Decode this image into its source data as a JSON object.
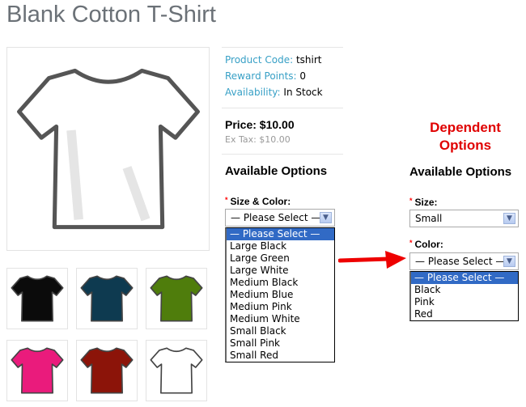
{
  "product": {
    "title": "Blank Cotton T-Shirt",
    "code_label": "Product Code:",
    "code": "tshirt",
    "points_label": "Reward Points:",
    "points": "0",
    "avail_label": "Availability:",
    "avail": "In Stock",
    "price": "Price: $10.00",
    "extax": "Ex Tax: $10.00"
  },
  "thumbnails": [
    {
      "color": "#0b0b0b"
    },
    {
      "color": "#0e3a50"
    },
    {
      "color": "#4f7d0c"
    },
    {
      "color": "#ea1b7c"
    },
    {
      "color": "#8c1409"
    },
    {
      "color": "#ffffff"
    }
  ],
  "left_options": {
    "heading": "Available Options",
    "label": "Size & Color:",
    "selected": "— Please Select —",
    "items": [
      "— Please Select —",
      "Large Black",
      "Large Green",
      "Large White",
      "Medium Black",
      "Medium Blue",
      "Medium Pink",
      "Medium White",
      "Small Black",
      "Small Pink",
      "Small Red"
    ]
  },
  "annotation": {
    "line1": "Dependent",
    "line2": "Options",
    "color": "#e00000"
  },
  "right_options": {
    "heading": "Available Options",
    "size_label": "Size:",
    "size_value": "Small",
    "color_label": "Color:",
    "color_selected": "— Please Select —",
    "items": [
      "— Please Select —",
      "Black",
      "Pink",
      "Red"
    ]
  }
}
